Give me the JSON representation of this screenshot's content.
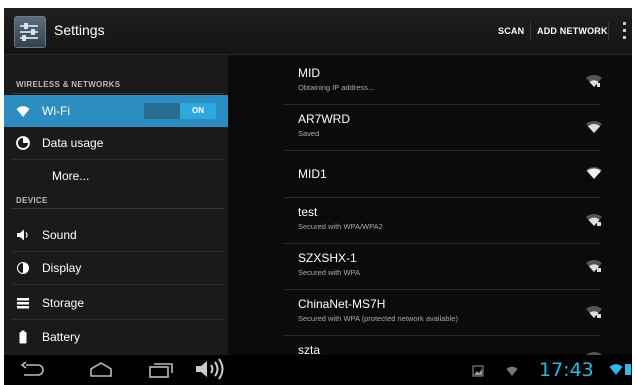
{
  "actionbar": {
    "title": "Settings",
    "scan_label": "SCAN",
    "add_network_label": "ADD NETWORK",
    "app_icon": "settings-icon",
    "overflow_icon": "overflow-menu-icon"
  },
  "sidebar": {
    "headers": [
      "WIRELESS & NETWORKS",
      "DEVICE"
    ],
    "items": [
      {
        "label": "Wi-Fi",
        "icon": "wifi-icon",
        "selected": true
      },
      {
        "label": "Data usage",
        "icon": "data-usage-icon"
      },
      {
        "label": "More..."
      },
      {
        "label": "Sound",
        "icon": "speaker-icon"
      },
      {
        "label": "Display",
        "icon": "brightness-icon"
      },
      {
        "label": "Storage",
        "icon": "storage-icon"
      },
      {
        "label": "Battery",
        "icon": "battery-icon"
      }
    ],
    "wifi_toggle": "ON"
  },
  "networks": [
    {
      "name": "MID",
      "status": "Obtaining IP address..."
    },
    {
      "name": "AR7WRD",
      "status": "Saved"
    },
    {
      "name": "MID1",
      "status": ""
    },
    {
      "name": "test",
      "status": "Secured with WPA/WPA2"
    },
    {
      "name": "SZXSHX-1",
      "status": "Secured with WPA"
    },
    {
      "name": "ChinaNet-MS7H",
      "status": "Secured with WPA (protected network available)"
    },
    {
      "name": "szta",
      "status": ""
    }
  ],
  "navbar": {
    "clock": "17:43",
    "icons": [
      "back-icon",
      "home-icon",
      "recent-apps-icon",
      "volume-icon"
    ]
  },
  "colors": {
    "accent": "#33b5e5",
    "selected_bg": "#2b8dc0",
    "background": "#0d0d0d"
  }
}
